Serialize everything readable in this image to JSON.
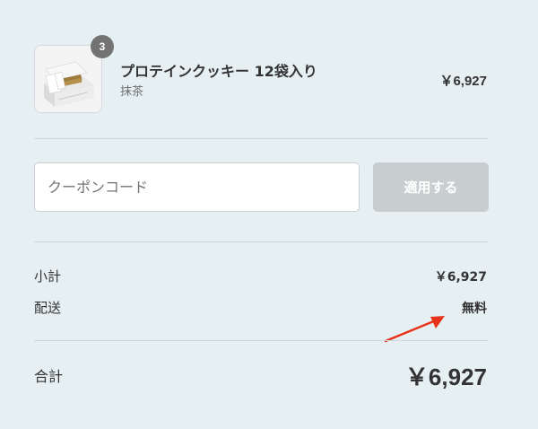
{
  "product": {
    "quantity": "3",
    "name": "プロテインクッキー 12袋入り",
    "variant": "抹茶",
    "price": "￥6,927"
  },
  "coupon": {
    "placeholder": "クーポンコード",
    "value": "",
    "apply_label": "適用する"
  },
  "summary": {
    "subtotal_label": "小計",
    "subtotal_value": "￥6,927",
    "shipping_label": "配送",
    "shipping_value": "無料",
    "total_label": "合計",
    "total_value": "￥6,927"
  },
  "colors": {
    "background": "#e6f0f3",
    "annotation_arrow": "#e8321a",
    "apply_button_disabled": "#c8cdcf"
  }
}
